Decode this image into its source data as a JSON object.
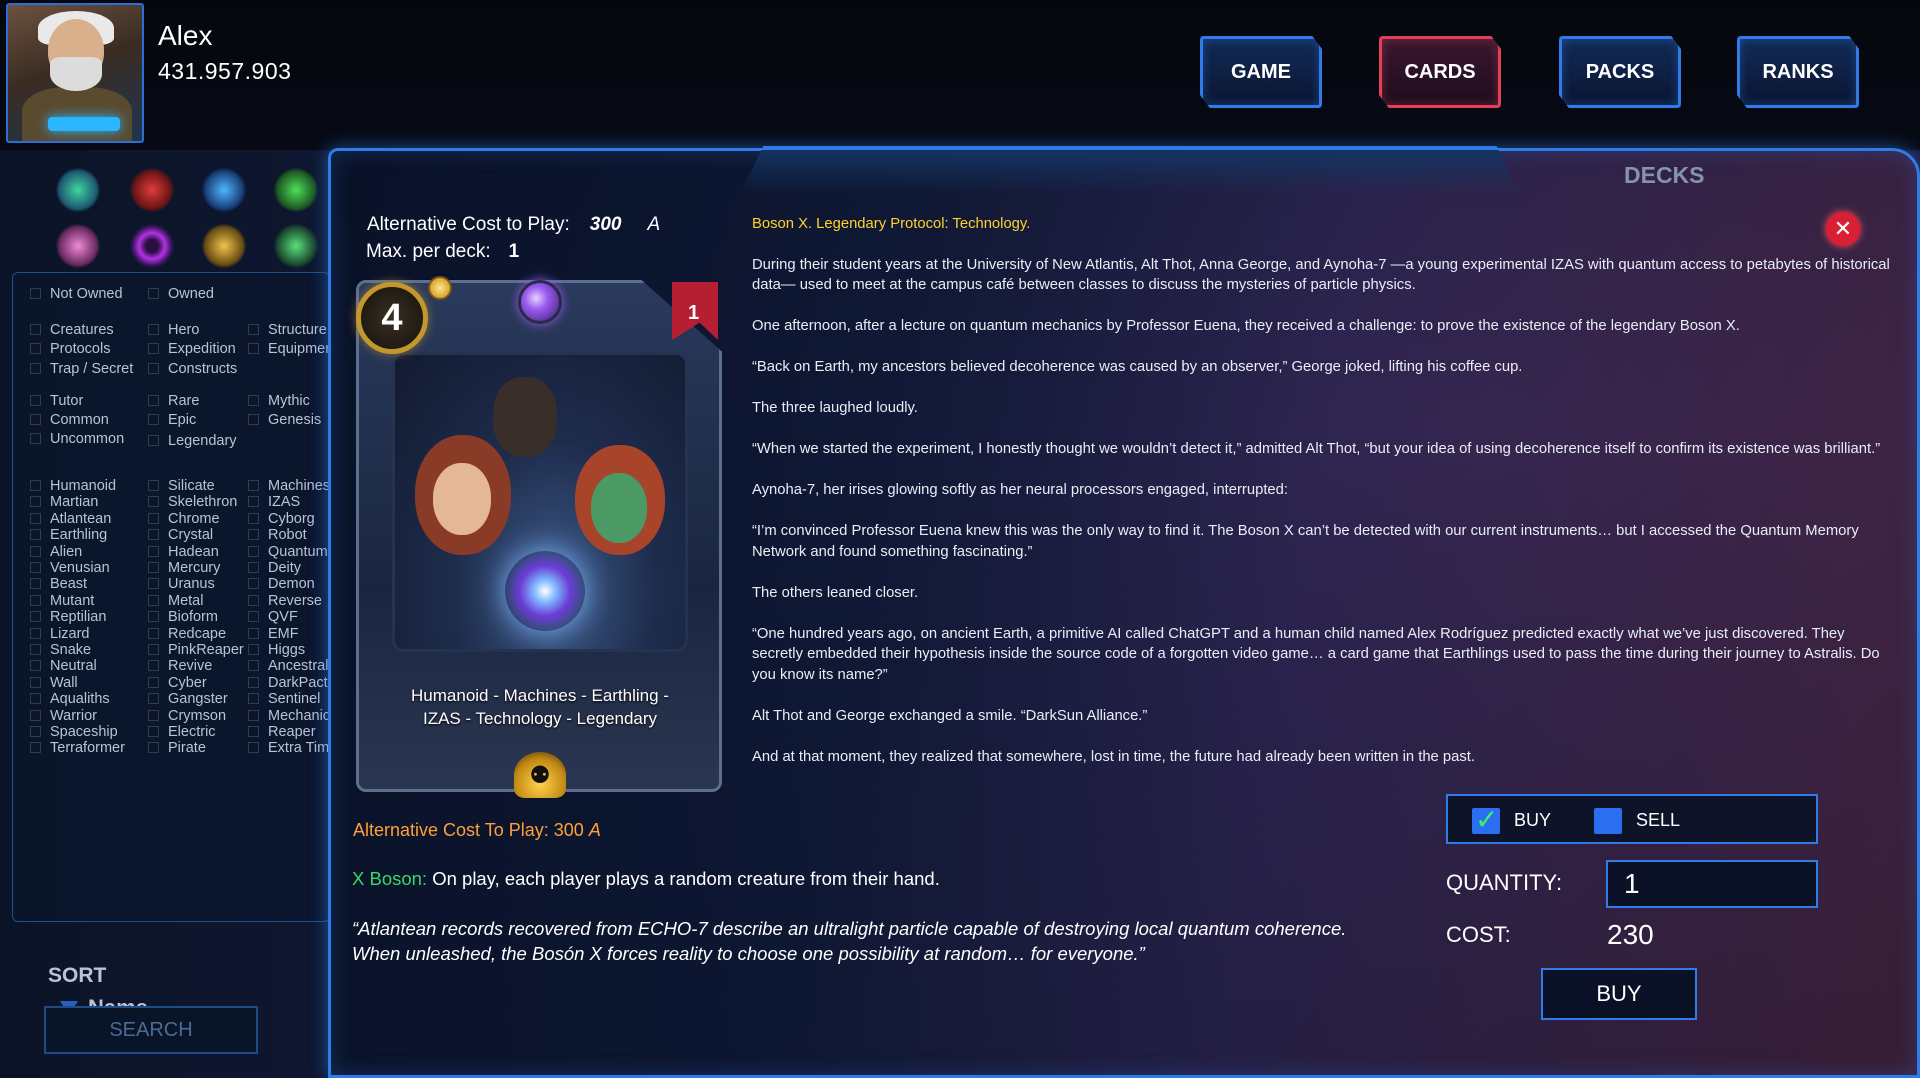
{
  "player": {
    "name": "Alex",
    "credits": "431.957.903"
  },
  "nav": {
    "game": "GAME",
    "cards": "CARDS",
    "packs": "PACKS",
    "ranks": "RANKS",
    "active": "CARDS"
  },
  "decks_label": "DECKS",
  "sidebar": {
    "ownership": [
      "Not Owned",
      "Owned"
    ],
    "card_types": [
      "Creatures",
      "Hero",
      "Structure",
      "Protocols",
      "Expedition",
      "Equipmen",
      "Trap / Secret",
      "Constructs"
    ],
    "rarities": [
      "Tutor",
      "Rare",
      "Mythic",
      "Common",
      "Epic",
      "Genesis",
      "Uncommon",
      "Legendary"
    ],
    "races": [
      "Humanoid",
      "Silicate",
      "Machines",
      "Martian",
      "Skelethron",
      "IZAS",
      "Atlantean",
      "Chrome",
      "Cyborg",
      "Earthling",
      "Crystal",
      "Robot",
      "Alien",
      "Hadean",
      "Quantum",
      "Venusian",
      "Mercury",
      "Deity",
      "Beast",
      "Uranus",
      "Demon",
      "Mutant",
      "Metal",
      "Reverse",
      "Reptilian",
      "Bioform",
      "QVF",
      "Lizard",
      "Redcape",
      "EMF",
      "Snake",
      "PinkReaper",
      "Higgs",
      "Neutral",
      "Revive",
      "Ancestral",
      "Wall",
      "Cyber",
      "DarkPact",
      "Aqualiths",
      "Gangster",
      "Sentinel",
      "Warrior",
      "Crymson",
      "Mechanic",
      "Spaceship",
      "Electric",
      "Reaper",
      "Terraformer",
      "Pirate",
      "Extra Tim"
    ],
    "sort_label": "SORT",
    "sort_value": "Name",
    "search_label": "SEARCH"
  },
  "card": {
    "alt_cost_label": "Alternative Cost to Play:",
    "alt_cost_value": "300",
    "alt_cost_symbol": "A",
    "max_per_deck_label": "Max. per deck:",
    "max_per_deck_value": "1",
    "cost": "4",
    "max_badge": "1",
    "types_line1": "Humanoid - Machines - Earthling -",
    "types_line2": "IZAS - Technology - Legendary",
    "alt_cost_full": "Alternative Cost To Play: 300",
    "ability_keyword": "X Boson:",
    "ability_text": " On play, each player plays a random creature from their hand.",
    "flavor_line1": "“Atlantean records recovered from ECHO-7 describe an ultralight particle capable of destroying local quantum coherence.",
    "flavor_line2": "When unleashed, the Bosón X forces reality to choose one possibility at random… for everyone.”"
  },
  "story": {
    "headline": "Boson X. Legendary Protocol: Technology.",
    "paragraphs": [
      "During their student years at the University of New Atlantis, Alt Thot, Anna George, and Aynoha-7 —a young experimental IZAS with quantum access to petabytes of historical data— used to meet at the campus café between classes to discuss the mysteries of particle physics.",
      "One afternoon, after a lecture on quantum mechanics by Professor Euena, they received a challenge: to prove the existence of the legendary Boson X.",
      "“Back on Earth, my ancestors believed decoherence was caused by an observer,” George joked, lifting his coffee cup.",
      "The three laughed loudly.",
      "“When we started the experiment, I honestly thought we wouldn’t detect it,” admitted Alt Thot, “but your idea of using decoherence itself to confirm its existence was brilliant.”",
      "Aynoha-7, her irises glowing softly as her neural processors engaged, interrupted:",
      "“I’m convinced Professor Euena knew this was the only way to find it. The Boson X can’t be detected with our current instruments… but I accessed the Quantum Memory Network and found something fascinating.”",
      "The others leaned closer.",
      "“One hundred years ago, on ancient Earth, a primitive AI called ChatGPT and a human child named Alex Rodríguez predicted exactly what we’ve just discovered. They secretly embedded their hypothesis inside the source code of a forgotten video game… a card game that Earthlings used to pass the time during their journey to Astralis. Do you know its name?”",
      "Alt Thot and George exchanged a smile. “DarkSun Alliance.”",
      "And at that moment, they realized that somewhere, lost in time, the future had already been written in the past."
    ]
  },
  "trade": {
    "buy_toggle": "BUY",
    "sell_toggle": "SELL",
    "buy_selected": true,
    "quantity_label": "QUANTITY:",
    "quantity_value": "1",
    "cost_label": "COST:",
    "cost_value": "230",
    "buy_button": "BUY"
  },
  "icons": {
    "close": "close-icon",
    "coin": "coin-icon",
    "faction": "quantum-orb-icon",
    "meditate": "meditating-figure-icon",
    "sort": "sort-triangle-icon"
  },
  "colors": {
    "accent_blue": "#2f7be8",
    "active_tab": "#e0405a",
    "headline": "#ffd22e",
    "alt_cost": "#ff9f3a",
    "ability_keyword": "#38d66b",
    "close": "#d91f33"
  }
}
